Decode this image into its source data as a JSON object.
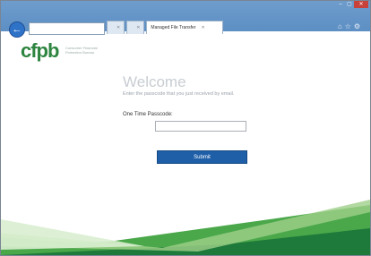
{
  "browser": {
    "address": "",
    "tabs": [
      {
        "label": "",
        "close": "✕"
      },
      {
        "label": "",
        "close": "✕"
      },
      {
        "label": "Managed File Transfer",
        "close": "✕"
      }
    ],
    "window_controls": [
      "–",
      "▢",
      "✕"
    ]
  },
  "header": {
    "logo": "cfpb",
    "logo_subtitle": "Consumer Financial Protection Bureau"
  },
  "main": {
    "title": "Welcome",
    "instruction": "Enter the passcode that you just received by email.",
    "passcode_label": "One Time Passcode:",
    "passcode_value": "",
    "submit_label": "Submit"
  },
  "colors": {
    "brand_green": "#2e8540",
    "submit_blue": "#1f5fa8",
    "titlebar": "#5d8fc4"
  },
  "icons": [
    "back-arrow-icon",
    "home-icon",
    "star-icon",
    "gear-icon"
  ]
}
